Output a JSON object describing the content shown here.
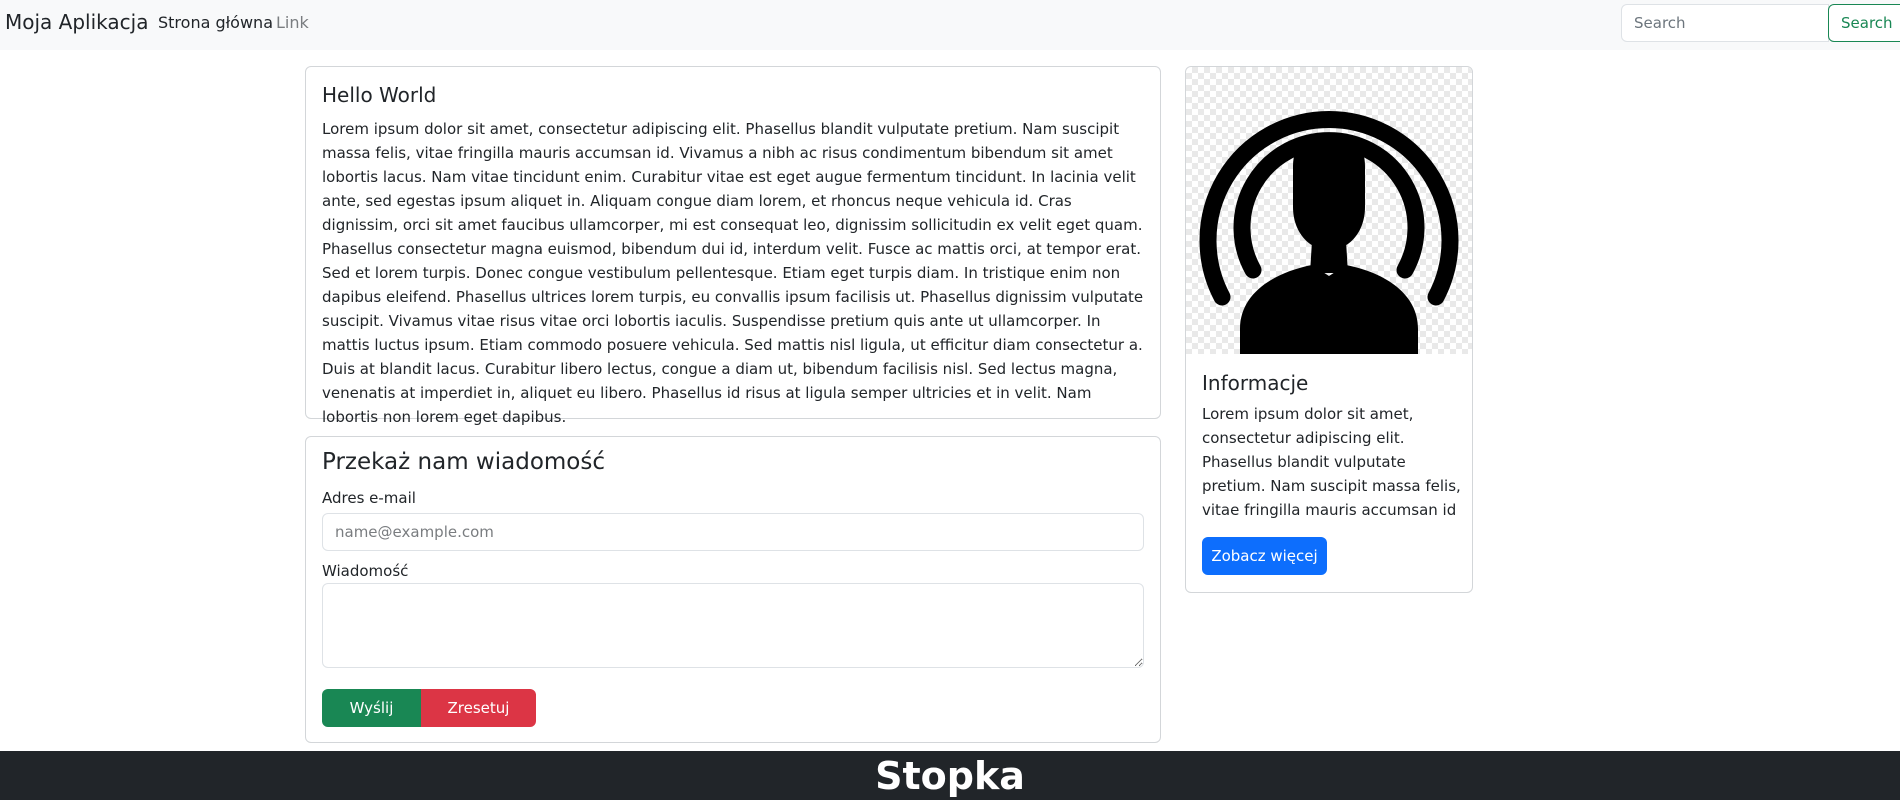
{
  "navbar": {
    "brand": "Moja Aplikacja",
    "links": [
      "Strona główna",
      "Link"
    ],
    "search_placeholder": "Search",
    "search_button": "Search"
  },
  "hello_card": {
    "title": "Hello World",
    "text": "Lorem ipsum dolor sit amet, consectetur adipiscing elit. Phasellus blandit vulputate pretium. Nam suscipit massa felis, vitae fringilla mauris accumsan id. Vivamus a nibh ac risus condimentum bibendum sit amet lobortis lacus. Nam vitae tincidunt enim. Curabitur vitae est eget augue fermentum tincidunt. In lacinia velit ante, sed egestas ipsum aliquet in. Aliquam congue diam lorem, et rhoncus neque vehicula id. Cras dignissim, orci sit amet faucibus ullamcorper, mi est consequat leo, dignissim sollicitudin ex velit eget quam. Phasellus consectetur magna euismod, bibendum dui id, interdum velit. Fusce ac mattis orci, at tempor erat. Sed et lorem turpis. Donec congue vestibulum pellentesque. Etiam eget turpis diam. In tristique enim non dapibus eleifend. Phasellus ultrices lorem turpis, eu convallis ipsum facilisis ut. Phasellus dignissim vulputate suscipit. Vivamus vitae risus vitae orci lobortis iaculis. Suspendisse pretium quis ante ut ullamcorper. In mattis luctus ipsum. Etiam commodo posuere vehicula. Sed mattis nisl ligula, ut efficitur diam consectetur a. Duis at blandit lacus. Curabitur libero lectus, congue a diam ut, bibendum facilisis nisl. Sed lectus magna, venenatis at imperdiet in, aliquet eu libero. Phasellus id risus at ligula semper ultricies et in velit. Nam lobortis non lorem eget dapibus."
  },
  "form": {
    "title": "Przekaż nam wiadomość",
    "email_label": "Adres e-mail",
    "email_placeholder": "name@example.com",
    "email_value": "",
    "message_label": "Wiadomość",
    "message_value": "",
    "submit_label": "Wyślij",
    "reset_label": "Zresetuj"
  },
  "info_card": {
    "image_icon": "person-broadcast-icon",
    "title": "Informacje",
    "text": "Lorem ipsum dolor sit amet, consectetur adipiscing elit. Phasellus blandit vulputate pretium. Nam suscipit massa felis, vitae fringilla mauris accumsan id",
    "button_label": "Zobacz więcej"
  },
  "footer": {
    "text": "Stopka"
  },
  "colors": {
    "primary": "#0d6efd",
    "success": "#198754",
    "danger": "#dc3545",
    "dark": "#212529",
    "light": "#f8f9fa"
  }
}
